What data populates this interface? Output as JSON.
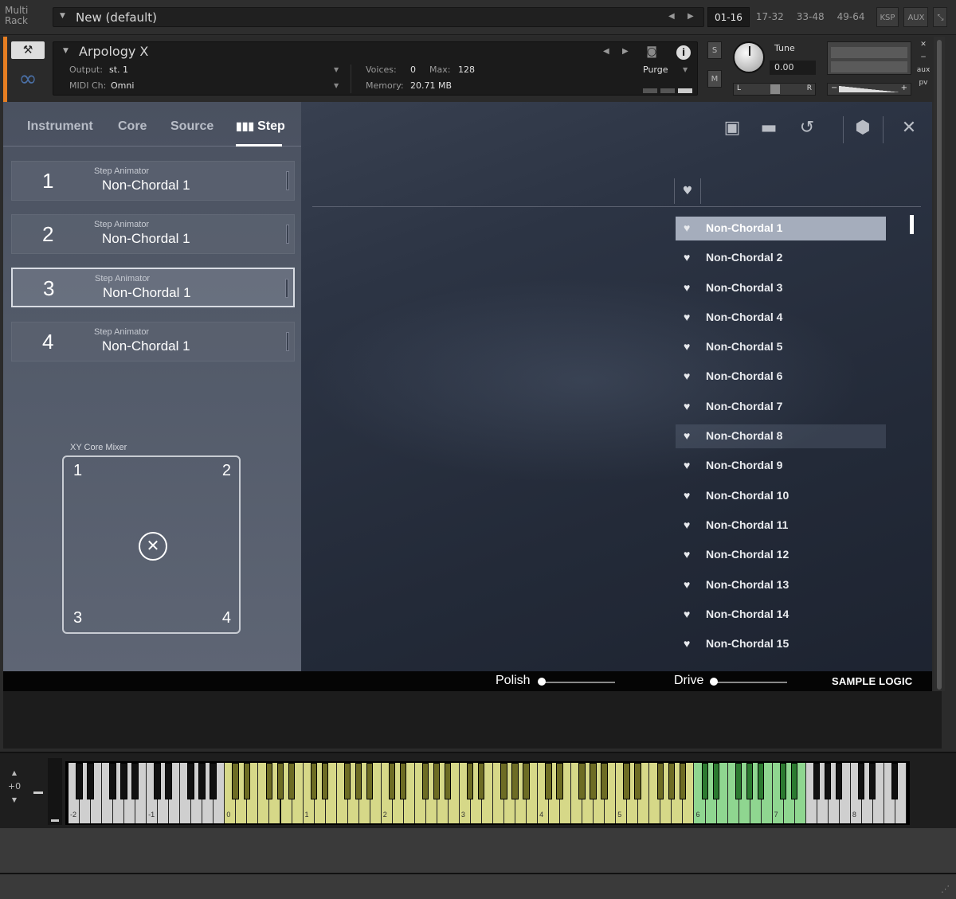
{
  "rack": {
    "label": "Multi\nRack",
    "preset": "New (default)",
    "tabs": [
      "01-16",
      "17-32",
      "33-48",
      "49-64",
      "KSP",
      "AUX"
    ],
    "active_tab": "01-16"
  },
  "instrument": {
    "name": "Arpology X",
    "output_label": "Output:",
    "output_value": "st. 1",
    "midi_label": "MIDI Ch:",
    "midi_value": "Omni",
    "voices_label": "Voices:",
    "voices_value": "0",
    "max_label": "Max:",
    "max_value": "128",
    "memory_label": "Memory:",
    "memory_value": "20.71 MB",
    "purge_label": "Purge",
    "s_label": "S",
    "m_label": "M",
    "tune_label": "Tune",
    "tune_value": "0.00",
    "pan_left": "L",
    "pan_right": "R",
    "vol_minus": "−",
    "vol_plus": "+",
    "side_close": "✕",
    "side_min": "−",
    "side_aux": "aux",
    "side_pv": "pv"
  },
  "tabs": [
    {
      "label": "Instrument"
    },
    {
      "label": "Core"
    },
    {
      "label": "Source"
    },
    {
      "label": "Step"
    }
  ],
  "active_tab": "Step",
  "step_slots": [
    {
      "number": "1",
      "subtitle": "Step Animator",
      "name": "Non-Chordal 1"
    },
    {
      "number": "2",
      "subtitle": "Step Animator",
      "name": "Non-Chordal 1"
    },
    {
      "number": "3",
      "subtitle": "Step Animator",
      "name": "Non-Chordal 1"
    },
    {
      "number": "4",
      "subtitle": "Step Animator",
      "name": "Non-Chordal 1"
    }
  ],
  "selected_slot": "3",
  "xy_mixer": {
    "label": "XY Core Mixer",
    "corners": [
      "1",
      "2",
      "3",
      "4"
    ],
    "cursor": "✕"
  },
  "presets": [
    "Non-Chordal 1",
    "Non-Chordal 2",
    "Non-Chordal 3",
    "Non-Chordal 4",
    "Non-Chordal 5",
    "Non-Chordal 6",
    "Non-Chordal 7",
    "Non-Chordal 8",
    "Non-Chordal 9",
    "Non-Chordal 10",
    "Non-Chordal 11",
    "Non-Chordal 12",
    "Non-Chordal 13",
    "Non-Chordal 14",
    "Non-Chordal 15"
  ],
  "selected_preset": "Non-Chordal 1",
  "hovered_preset": "Non-Chordal 8",
  "bottom": {
    "polish_label": "Polish",
    "polish_value": 0.0,
    "drive_label": "Drive",
    "drive_value": 0.0,
    "brand": "SAMPLE LOGIC"
  },
  "keyboard": {
    "transpose": "+0",
    "octave_labels": [
      "-2",
      "-1",
      "0",
      "1",
      "2",
      "3",
      "4",
      "5",
      "6",
      "7",
      "8"
    ]
  },
  "colors": {
    "accent_orange": "#e67e22",
    "key_yellow": "#d6d888",
    "key_green": "#8fd690",
    "selected_preset_bg": "#a5adbc"
  }
}
